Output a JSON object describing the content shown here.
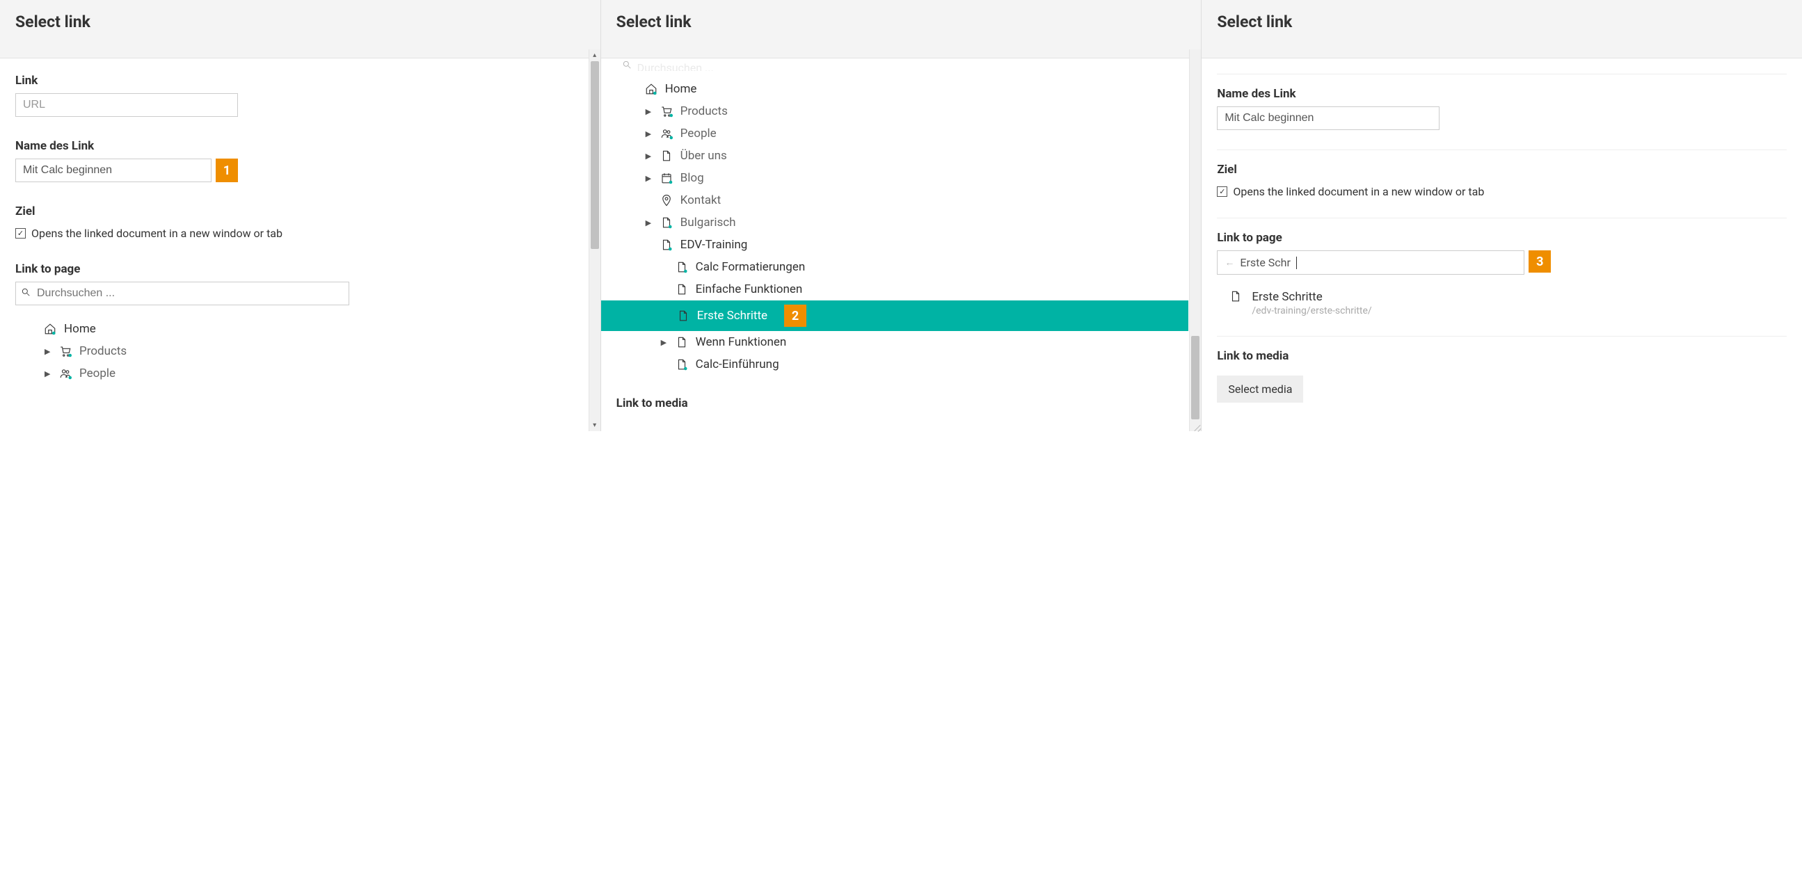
{
  "panel1": {
    "title": "Select link",
    "link_label": "Link",
    "url_placeholder": "URL",
    "name_label": "Name des Link",
    "name_value": "Mit Calc beginnen",
    "badge": "1",
    "ziel_label": "Ziel",
    "ziel_checkbox_label": "Opens the linked document in a new window or tab",
    "link_to_page_label": "Link to page",
    "search_placeholder": "Durchsuchen ...",
    "tree": [
      {
        "label": "Home",
        "icon": "home",
        "indent": 0,
        "caret": false,
        "muted": false
      },
      {
        "label": "Products",
        "icon": "cart",
        "indent": 1,
        "caret": true,
        "muted": true
      },
      {
        "label": "People",
        "icon": "people",
        "indent": 1,
        "caret": true,
        "muted": true
      }
    ]
  },
  "panel2": {
    "title": "Select link",
    "search_truncated": "Durchsuchen ...",
    "tree": [
      {
        "label": "Home",
        "icon": "home",
        "indent": 0,
        "caret": false,
        "muted": false
      },
      {
        "label": "Products",
        "icon": "cart",
        "indent": 1,
        "caret": true,
        "muted": true
      },
      {
        "label": "People",
        "icon": "people",
        "indent": 1,
        "caret": true,
        "muted": true
      },
      {
        "label": "Über uns",
        "icon": "doc",
        "indent": 1,
        "caret": true,
        "muted": true
      },
      {
        "label": "Blog",
        "icon": "calendar",
        "indent": 1,
        "caret": true,
        "muted": true
      },
      {
        "label": "Kontakt",
        "icon": "pin",
        "indent": 1,
        "caret": false,
        "muted": true
      },
      {
        "label": "Bulgarisch",
        "icon": "doc",
        "indent": 1,
        "caret": true,
        "muted": true
      },
      {
        "label": "EDV-Training",
        "icon": "doc",
        "indent": 1,
        "caret": false,
        "muted": false
      },
      {
        "label": "Calc Formatierungen",
        "icon": "doc",
        "indent": 2,
        "caret": false,
        "muted": false
      },
      {
        "label": "Einfache Funktionen",
        "icon": "doc",
        "indent": 2,
        "caret": false,
        "muted": false
      },
      {
        "label": "Erste Schritte",
        "icon": "doc",
        "indent": 2,
        "caret": false,
        "muted": false,
        "selected": true,
        "badge": "2"
      },
      {
        "label": "Wenn Funktionen",
        "icon": "doc",
        "indent": 2,
        "caret": true,
        "muted": false
      },
      {
        "label": "Calc-Einführung",
        "icon": "doc",
        "indent": 2,
        "caret": false,
        "muted": false
      }
    ],
    "link_to_media_label": "Link to media"
  },
  "panel3": {
    "title": "Select link",
    "name_label": "Name des Link",
    "name_value": "Mit Calc beginnen",
    "ziel_label": "Ziel",
    "ziel_checkbox_label": "Opens the linked document in a new window or tab",
    "link_to_page_label": "Link to page",
    "page_search_value": "Erste Schr",
    "badge": "3",
    "result_title": "Erste Schritte",
    "result_path": "/edv-training/erste-schritte/",
    "link_to_media_label": "Link to media",
    "select_media_label": "Select media"
  }
}
